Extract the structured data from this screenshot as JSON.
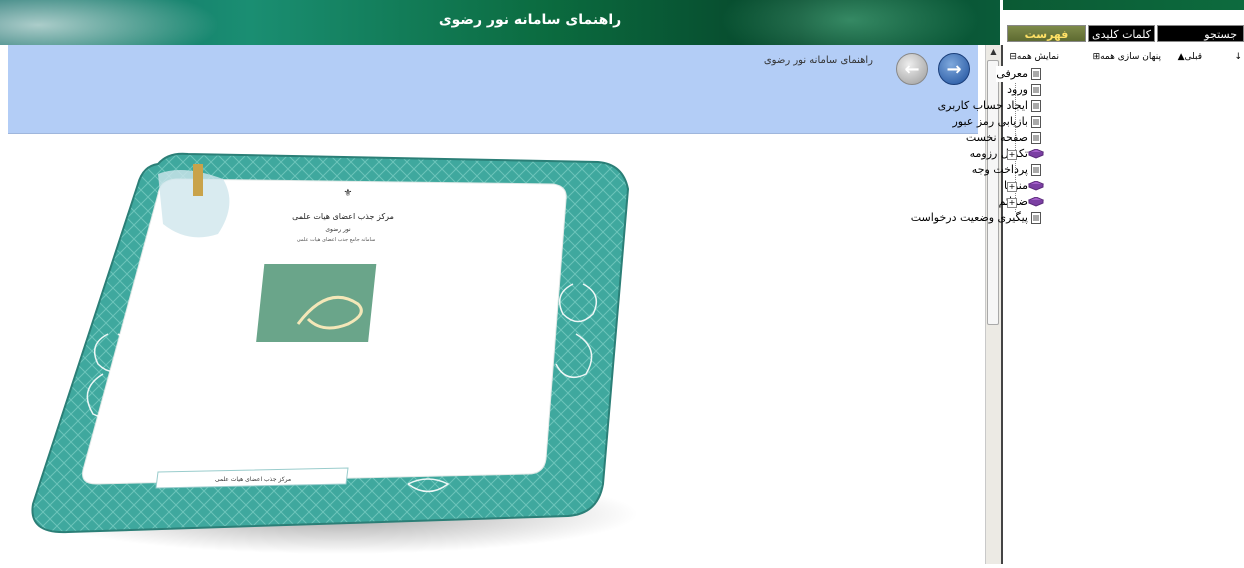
{
  "banner": {
    "title": "راهنمای سامانه نور رضوی"
  },
  "content": {
    "topic_title": "راهنمای سامانه نور رضوی",
    "frame_footer": "مرکز جذب اعضای هیات علمی",
    "doc_header_line1": "مرکز جذب اعضای هیات علمی",
    "doc_header_line2": "نور رضوی",
    "doc_header_line3": "سامانه جامع جذب اعضای هیات علمی"
  },
  "nav": {
    "back_icon": "arrow-left-icon",
    "forward_icon": "arrow-right-icon"
  },
  "sidebar": {
    "tabs": [
      "فهرست",
      "کلمات کلیدی",
      "جستجو"
    ],
    "toolbar": {
      "down": "↓",
      "prev": "قبلی",
      "hide_all": "پنهان سازی همه",
      "show_all": "نمایش همه"
    },
    "tree": [
      {
        "label": "معرفی",
        "type": "page",
        "selected": true
      },
      {
        "label": "ورود",
        "type": "page"
      },
      {
        "label": "ایجاد حساب کاربری",
        "type": "page"
      },
      {
        "label": "بازیابی رمز عبور",
        "type": "page"
      },
      {
        "label": "صفحه نخست",
        "type": "page"
      },
      {
        "label": "تکمیل رزومه",
        "type": "book",
        "expandable": true
      },
      {
        "label": "پرداخت وجه",
        "type": "page"
      },
      {
        "label": "منوها",
        "type": "book",
        "expandable": true
      },
      {
        "label": "ضمائم",
        "type": "book",
        "expandable": true
      },
      {
        "label": "پیگیری وضعیت درخواست",
        "type": "page"
      }
    ]
  },
  "colors": {
    "title_bar": "#b3cdf6",
    "frame_teal": "#3aa39a",
    "tab_active_text": "#ffe066"
  }
}
